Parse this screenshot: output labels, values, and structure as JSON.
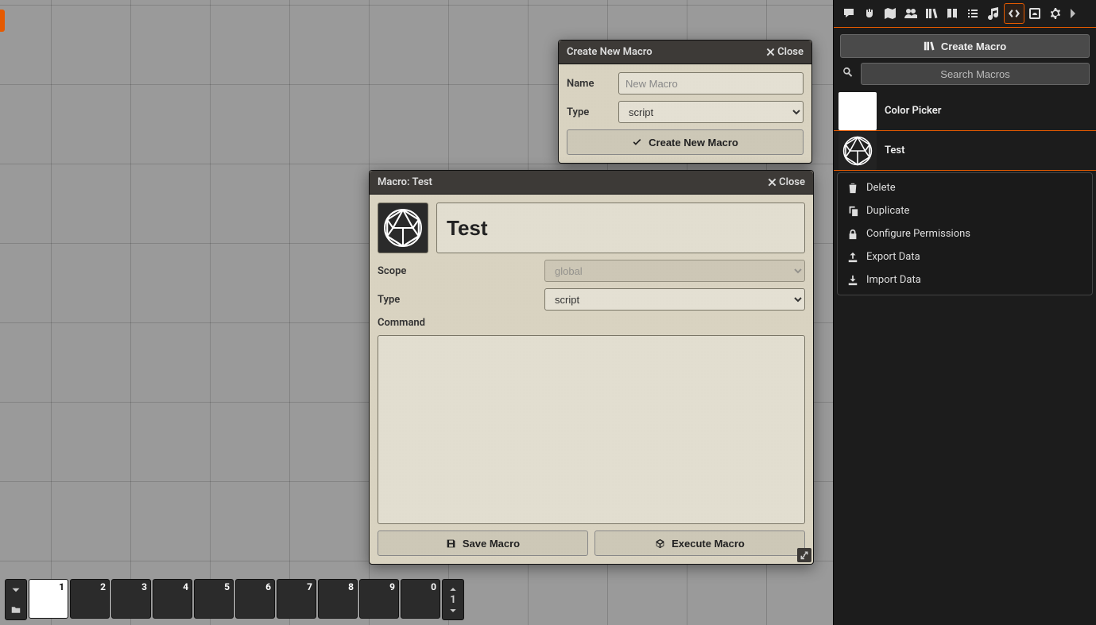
{
  "sidebar": {
    "create_button": "Create Macro",
    "search_placeholder": "Search Macros",
    "items": [
      {
        "label": "Color Picker"
      },
      {
        "label": "Test"
      }
    ],
    "context_menu": [
      {
        "label": "Delete"
      },
      {
        "label": "Duplicate"
      },
      {
        "label": "Configure Permissions"
      },
      {
        "label": "Export Data"
      },
      {
        "label": "Import Data"
      }
    ]
  },
  "create_macro_window": {
    "title": "Create New Macro",
    "close": "Close",
    "name_label": "Name",
    "name_placeholder": "New Macro",
    "type_label": "Type",
    "type_value": "script",
    "submit": "Create New Macro"
  },
  "macro_editor": {
    "title": "Macro: Test",
    "close": "Close",
    "name_value": "Test",
    "scope_label": "Scope",
    "scope_value": "global",
    "type_label": "Type",
    "type_value": "script",
    "command_label": "Command",
    "command_value": "",
    "save": "Save Macro",
    "execute": "Execute Macro"
  },
  "hotbar": {
    "page": "1",
    "slots": [
      "1",
      "2",
      "3",
      "4",
      "5",
      "6",
      "7",
      "8",
      "9",
      "0"
    ]
  }
}
